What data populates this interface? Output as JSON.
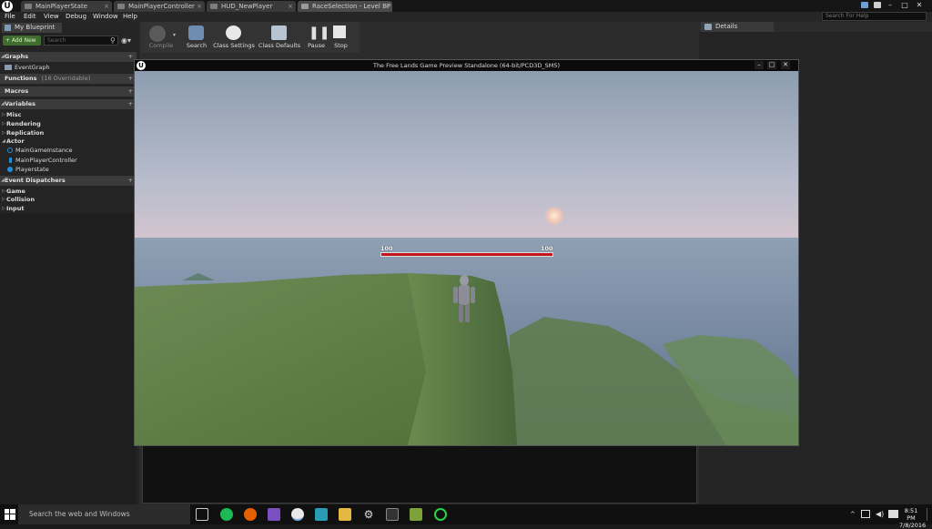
{
  "tabs": [
    {
      "label": "MainPlayerState",
      "active": false
    },
    {
      "label": "MainPlayerController",
      "active": false
    },
    {
      "label": "HUD_NewPlayer",
      "active": false
    },
    {
      "label": "RaceSelection - Level BP",
      "active": true
    }
  ],
  "menu": [
    "File",
    "Edit",
    "View",
    "Debug",
    "Window",
    "Help"
  ],
  "help_search_placeholder": "Search For Help",
  "my_blueprint": {
    "tab_label": "My Blueprint",
    "add_new_label": "+ Add New",
    "search_placeholder": "Search",
    "sections": {
      "graphs": "Graphs",
      "event_graph": "EventGraph",
      "functions": "Functions",
      "functions_note": "(16 Overridable)",
      "macros": "Macros",
      "variables": "Variables",
      "event_dispatchers": "Event Dispatchers"
    },
    "variable_categories": [
      "Misc",
      "Rendering",
      "Replication",
      "Actor"
    ],
    "variables": [
      {
        "name": "MainGameInstance",
        "color": "#1e8fd8"
      },
      {
        "name": "MainPlayerController",
        "color": "#1e8fd8"
      },
      {
        "name": "Playerstate",
        "color": "#1e8fd8"
      }
    ],
    "dispatcher_categories": [
      "Game",
      "Collision",
      "Input"
    ]
  },
  "toolbar": [
    {
      "label": "Compile"
    },
    {
      "label": "Search"
    },
    {
      "label": "Class Settings"
    },
    {
      "label": "Class Defaults"
    },
    {
      "label": "Pause"
    },
    {
      "label": "Stop"
    }
  ],
  "details_label": "Details",
  "game_window": {
    "title": "The Free Lands Game Preview Standalone (64-bit/PCD3D_SM5)",
    "health_left": "100",
    "health_right": "100",
    "health_fraction": 1.0
  },
  "taskbar": {
    "search_placeholder": "Search the web and Windows",
    "time": "8:51 PM",
    "date": "7/8/2016"
  }
}
